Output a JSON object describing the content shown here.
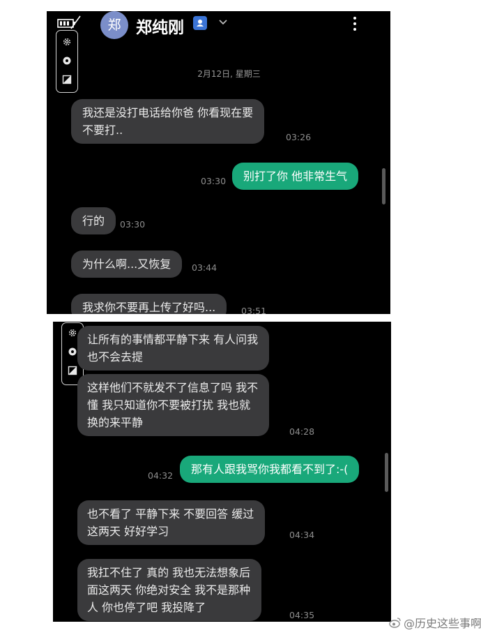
{
  "header": {
    "avatar_text": "郑",
    "contact_name": "郑纯刚"
  },
  "icons": {
    "battery": "battery-low-icon",
    "contact_badge": "contact-card-icon",
    "chevron": "chevron-down-icon",
    "more": "more-vertical-icon",
    "toolbar": [
      "gear-icon",
      "shutter-icon",
      "contrast-icon"
    ]
  },
  "top_panel": {
    "date": "2月12日, 星期三",
    "messages": [
      {
        "dir": "in",
        "lines": [
          "我还是没打电话给你爸 你看现在要",
          "不要打.."
        ],
        "time": "03:26"
      },
      {
        "dir": "out",
        "lines": [
          "别打了你 他非常生气"
        ],
        "time": "03:30"
      },
      {
        "dir": "in",
        "lines": [
          "行的"
        ],
        "time": "03:30"
      },
      {
        "dir": "in",
        "lines": [
          "为什么啊...又恢复"
        ],
        "time": "03:44"
      },
      {
        "dir": "in",
        "lines": [
          "我求你不要再上传了好吗..."
        ],
        "time": "03:51"
      }
    ]
  },
  "bottom_panel": {
    "messages": [
      {
        "dir": "in",
        "lines": [
          "让所有的事情都平静下来 有人问我",
          "也不会去提"
        ],
        "time": ""
      },
      {
        "dir": "in",
        "lines": [
          "这样他们不就发不了信息了吗 我不",
          "懂 我只知道你不要被打扰 我也就",
          "换的来平静"
        ],
        "time": "04:28"
      },
      {
        "dir": "out",
        "lines": [
          "那有人跟我骂你我都看不到了:-("
        ],
        "time": "04:32"
      },
      {
        "dir": "in",
        "lines": [
          "也不看了 平静下来 不要回答 缓过",
          "这两天 好好学习"
        ],
        "time": "04:34"
      },
      {
        "dir": "in",
        "lines": [
          "我扛不住了 真的 我也无法想象后",
          "面这两天 你绝对安全 我不是那种",
          "人 你也停了吧 我投降了"
        ],
        "time": "04:35"
      }
    ]
  },
  "watermark": {
    "text": "@历史这些事啊",
    "icon": "weibo-icon"
  },
  "colors": {
    "background": "#000000",
    "incoming_bubble": "#3a3a3c",
    "outgoing_bubble": "#19a87a",
    "timestamp": "#8e8e8e"
  }
}
